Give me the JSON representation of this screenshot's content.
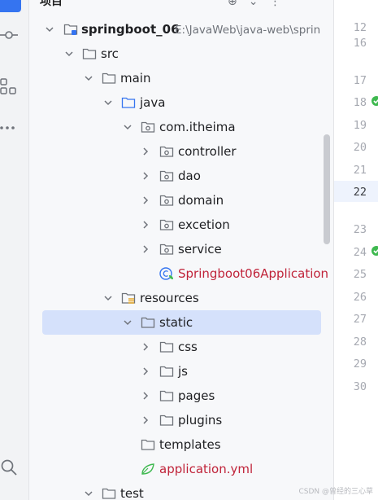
{
  "header": {
    "title": "项目",
    "icons": [
      "crosshair-icon",
      "chevron-icon",
      "more-icon"
    ]
  },
  "toolstrip": {
    "icons": [
      "commit-icon",
      "structure-icon",
      "more-tools-icon",
      "search-icon"
    ]
  },
  "tree": {
    "rows": [
      {
        "label": "springboot_06",
        "path": "E:\\JavaWeb\\java-web\\sprin",
        "type": "module",
        "expanded": true
      },
      {
        "label": "src",
        "type": "folder",
        "expanded": true
      },
      {
        "label": "main",
        "type": "folder",
        "expanded": true
      },
      {
        "label": "java",
        "type": "source-folder",
        "expanded": true
      },
      {
        "label": "com.itheima",
        "type": "package",
        "expanded": true
      },
      {
        "label": "controller",
        "type": "package",
        "expanded": false
      },
      {
        "label": "dao",
        "type": "package",
        "expanded": false
      },
      {
        "label": "domain",
        "type": "package",
        "expanded": false
      },
      {
        "label": "excetion",
        "type": "package",
        "expanded": false
      },
      {
        "label": "service",
        "type": "package",
        "expanded": false
      },
      {
        "label": "Springboot06Application",
        "type": "spring-class",
        "color": "#c0243a"
      },
      {
        "label": "resources",
        "type": "resources-folder",
        "expanded": true
      },
      {
        "label": "static",
        "type": "folder",
        "expanded": true,
        "selected": true
      },
      {
        "label": "css",
        "type": "folder",
        "expanded": false
      },
      {
        "label": "js",
        "type": "folder",
        "expanded": false
      },
      {
        "label": "pages",
        "type": "folder",
        "expanded": false
      },
      {
        "label": "plugins",
        "type": "folder",
        "expanded": false
      },
      {
        "label": "templates",
        "type": "folder"
      },
      {
        "label": "application.yml",
        "type": "yaml-file",
        "color": "#c0243a"
      },
      {
        "label": "test",
        "type": "folder",
        "expanded": false
      }
    ]
  },
  "gutter": {
    "lines": [
      "12",
      "16",
      "17",
      "18",
      "19",
      "20",
      "21",
      "22",
      "23",
      "24",
      "25",
      "26",
      "27",
      "28",
      "29",
      "30"
    ],
    "current_line": "22"
  },
  "watermark": "CSDN @曾经的三心草",
  "colors": {
    "selection": "#d5e1fb",
    "accent": "#3574f0",
    "error_text": "#c0243a",
    "run_marker": "#3fb950"
  }
}
